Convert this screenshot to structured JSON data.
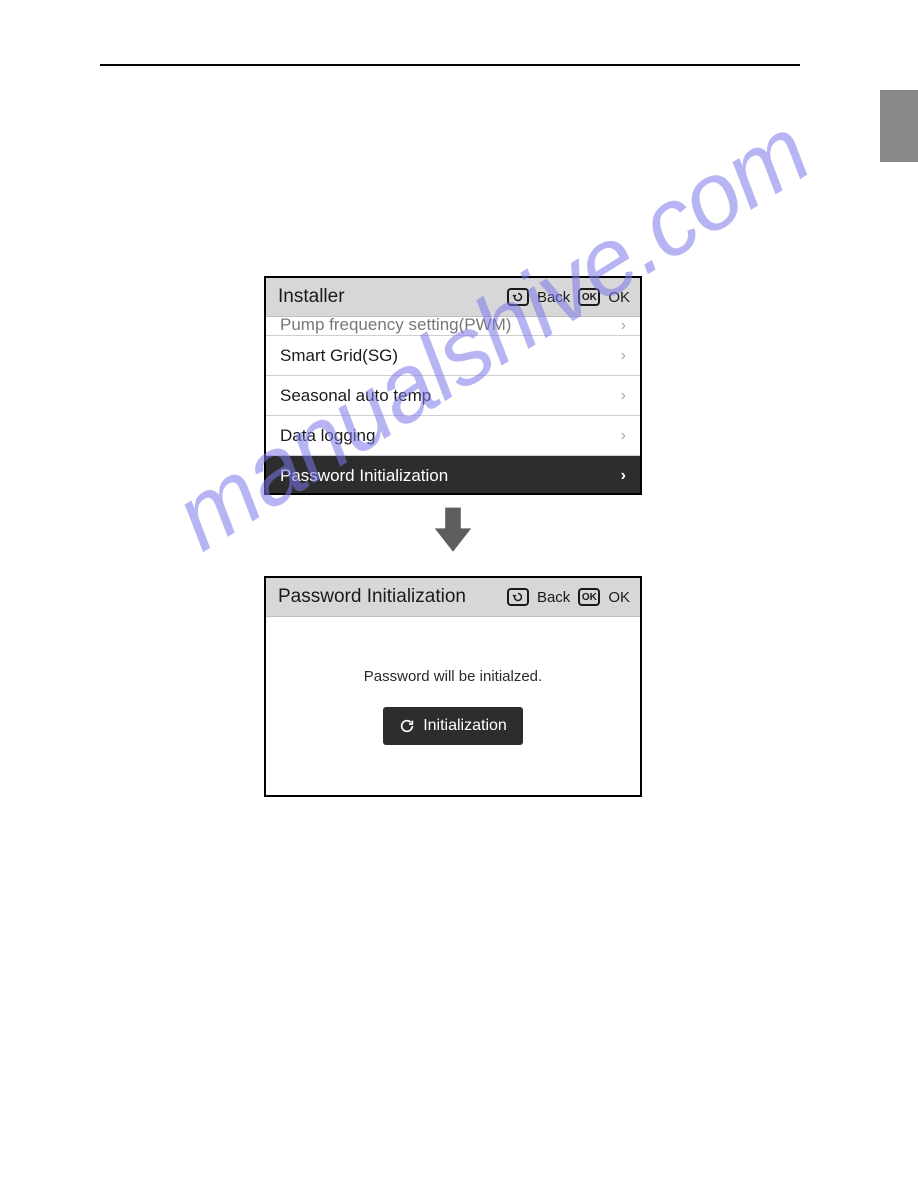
{
  "watermark": "manualshive.com",
  "panel1": {
    "title": "Installer",
    "back_label": "Back",
    "ok_label": "OK",
    "rows": [
      {
        "label": "Pump frequency setting(PWM)",
        "cut": true
      },
      {
        "label": "Smart Grid(SG)"
      },
      {
        "label": "Seasonal auto temp"
      },
      {
        "label": "Data logging"
      },
      {
        "label": "Password Initialization",
        "selected": true
      }
    ]
  },
  "panel2": {
    "title": "Password Initialization",
    "back_label": "Back",
    "ok_label": "OK",
    "message": "Password will be initialzed.",
    "button_label": "Initialization"
  }
}
